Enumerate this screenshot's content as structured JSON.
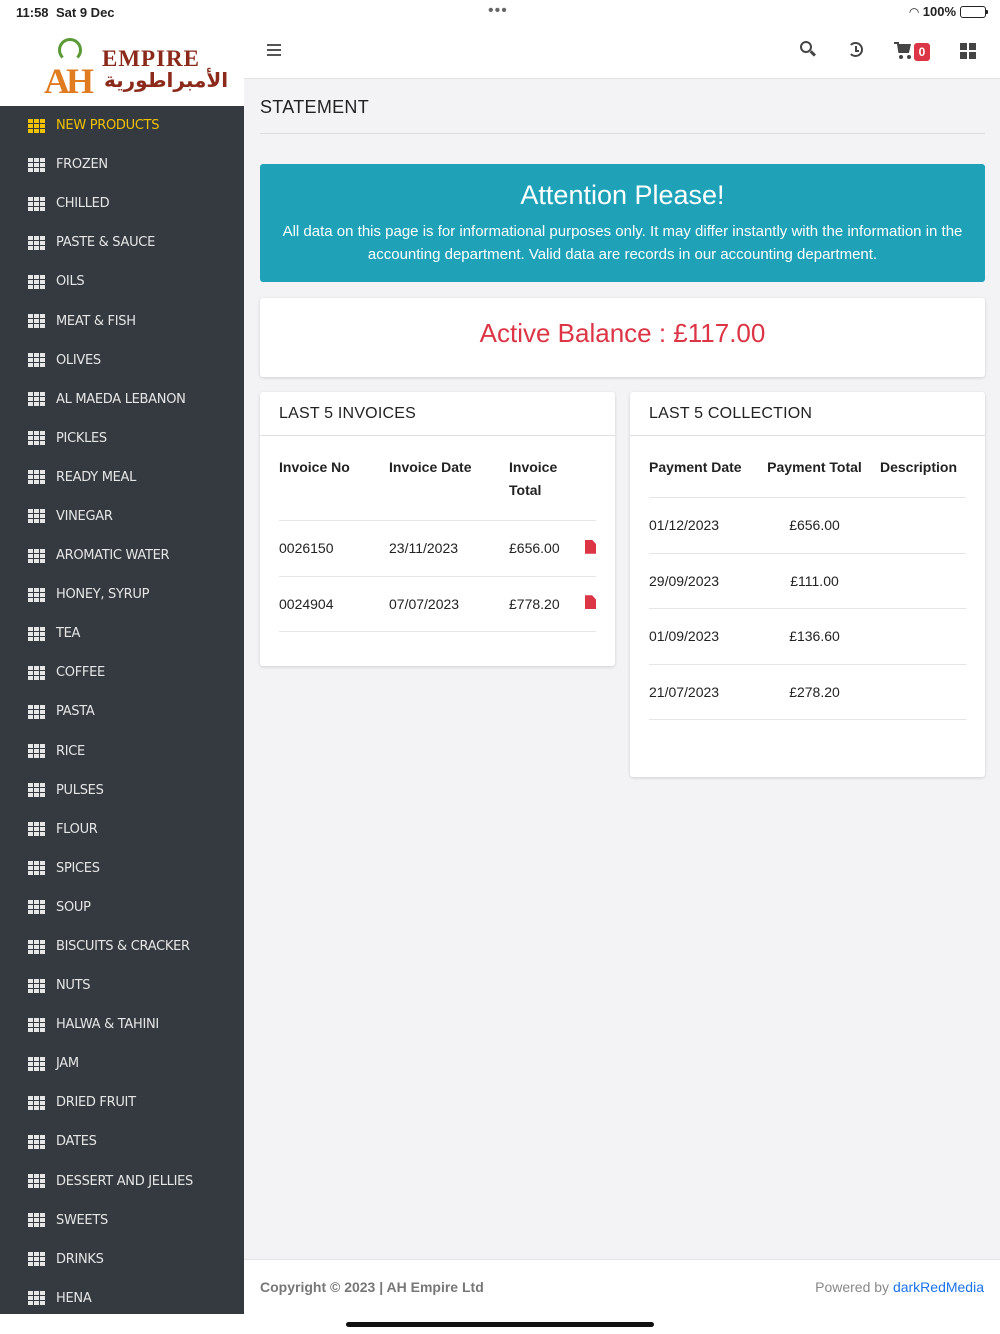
{
  "statusbar": {
    "time": "11:58",
    "date": "Sat 9 Dec",
    "battery": "100%"
  },
  "logo": {
    "mark": "AH",
    "name": "EMPIRE",
    "arabic": "الأمبراطورية"
  },
  "sidebar": {
    "items": [
      {
        "label": "NEW PRODUCTS",
        "active": true
      },
      {
        "label": "FROZEN"
      },
      {
        "label": "CHILLED"
      },
      {
        "label": "PASTE & SAUCE"
      },
      {
        "label": "OILS"
      },
      {
        "label": "MEAT & FISH"
      },
      {
        "label": "OLIVES"
      },
      {
        "label": "AL MAEDA LEBANON"
      },
      {
        "label": "PICKLES"
      },
      {
        "label": "READY MEAL"
      },
      {
        "label": "VINEGAR"
      },
      {
        "label": "AROMATIC WATER"
      },
      {
        "label": "HONEY, SYRUP"
      },
      {
        "label": "TEA"
      },
      {
        "label": "COFFEE"
      },
      {
        "label": "PASTA"
      },
      {
        "label": "RICE"
      },
      {
        "label": "PULSES"
      },
      {
        "label": "FLOUR"
      },
      {
        "label": "SPICES"
      },
      {
        "label": "SOUP"
      },
      {
        "label": "BISCUITS & CRACKER"
      },
      {
        "label": "NUTS"
      },
      {
        "label": "HALWA & TAHINI"
      },
      {
        "label": "JAM"
      },
      {
        "label": "DRIED FRUIT"
      },
      {
        "label": "DATES"
      },
      {
        "label": "DESSERT AND JELLIES"
      },
      {
        "label": "SWEETS"
      },
      {
        "label": "DRINKS"
      },
      {
        "label": "HENA"
      }
    ]
  },
  "topbar": {
    "cart_count": "0",
    "icons": [
      "menu-icon",
      "search-icon",
      "history-icon",
      "cart-icon",
      "grid-icon"
    ]
  },
  "page": {
    "title": "STATEMENT"
  },
  "alert": {
    "title": "Attention Please!",
    "message": "All data on this page is for informational purposes only. It may differ instantly with the information in the accounting department. Valid data are records in our accounting department."
  },
  "balance": {
    "text": "Active Balance : £117.00"
  },
  "invoices": {
    "title": "LAST 5 INVOICES",
    "headers": [
      "Invoice No",
      "Invoice Date",
      "Invoice Total"
    ],
    "rows": [
      {
        "no": "0026150",
        "date": "23/11/2023",
        "total": "£656.00"
      },
      {
        "no": "0024904",
        "date": "07/07/2023",
        "total": "£778.20"
      }
    ]
  },
  "collections": {
    "title": "LAST 5 COLLECTION",
    "headers": [
      "Payment Date",
      "Payment Total",
      "Description"
    ],
    "rows": [
      {
        "date": "01/12/2023",
        "total": "£656.00",
        "description": ""
      },
      {
        "date": "29/09/2023",
        "total": "£111.00",
        "description": ""
      },
      {
        "date": "01/09/2023",
        "total": "£136.60",
        "description": ""
      },
      {
        "date": "21/07/2023",
        "total": "£278.20",
        "description": ""
      }
    ]
  },
  "footer": {
    "copyright": "Copyright © 2023 | AH Empire Ltd",
    "powered_prefix": "Powered by ",
    "powered_link": "darkRedMedia"
  },
  "colors": {
    "sidebar_bg": "#343a40",
    "active": "#f2c200",
    "alert_bg": "#1fa2b8",
    "danger": "#dc3545",
    "link": "#1a73e8"
  }
}
